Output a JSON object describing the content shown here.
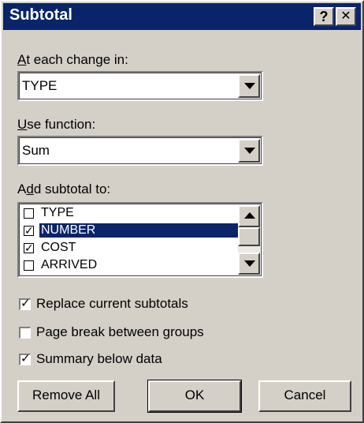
{
  "window": {
    "title": "Subtotal",
    "help_button": "?",
    "close_button": "✕"
  },
  "at_each_change": {
    "label": "At each change in:",
    "value": "TYPE"
  },
  "use_function": {
    "label": "Use function:",
    "value": "Sum"
  },
  "add_subtotal": {
    "label": "Add subtotal to:",
    "items": [
      {
        "label": "TYPE",
        "checked": false,
        "selected": false
      },
      {
        "label": "NUMBER",
        "checked": true,
        "selected": true
      },
      {
        "label": "COST",
        "checked": true,
        "selected": false
      },
      {
        "label": "ARRIVED",
        "checked": false,
        "selected": false
      }
    ]
  },
  "options": {
    "replace": {
      "label": "Replace current subtotals",
      "checked": true
    },
    "page_break": {
      "label": "Page break between groups",
      "checked": false
    },
    "summary_below": {
      "label": "Summary below data",
      "checked": true
    }
  },
  "buttons": {
    "remove_all": "Remove All",
    "ok": "OK",
    "cancel": "Cancel"
  },
  "colors": {
    "titlebar": "#0a246a",
    "face": "#d4d0c8",
    "selection": "#0a246a"
  }
}
